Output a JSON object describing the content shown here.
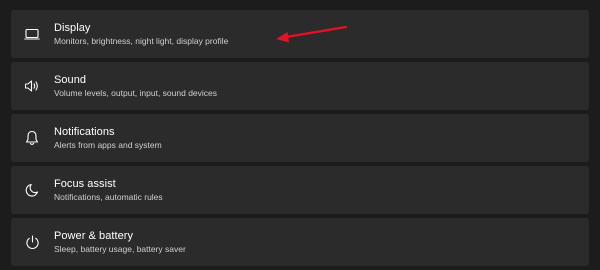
{
  "settings": {
    "items": [
      {
        "icon": "laptop-icon",
        "title": "Display",
        "subtitle": "Monitors, brightness, night light, display profile"
      },
      {
        "icon": "speaker-icon",
        "title": "Sound",
        "subtitle": "Volume levels, output, input, sound devices"
      },
      {
        "icon": "bell-icon",
        "title": "Notifications",
        "subtitle": "Alerts from apps and system"
      },
      {
        "icon": "moon-icon",
        "title": "Focus assist",
        "subtitle": "Notifications, automatic rules"
      },
      {
        "icon": "power-icon",
        "title": "Power & battery",
        "subtitle": "Sleep, battery usage, battery saver"
      }
    ]
  },
  "annotation": {
    "icon": "red-arrow-icon",
    "color": "#e81123"
  },
  "colors": {
    "background": "#1c1c1c",
    "card": "#2b2b2b",
    "title_text": "#ffffff",
    "subtitle_text": "#cfcfcf"
  }
}
